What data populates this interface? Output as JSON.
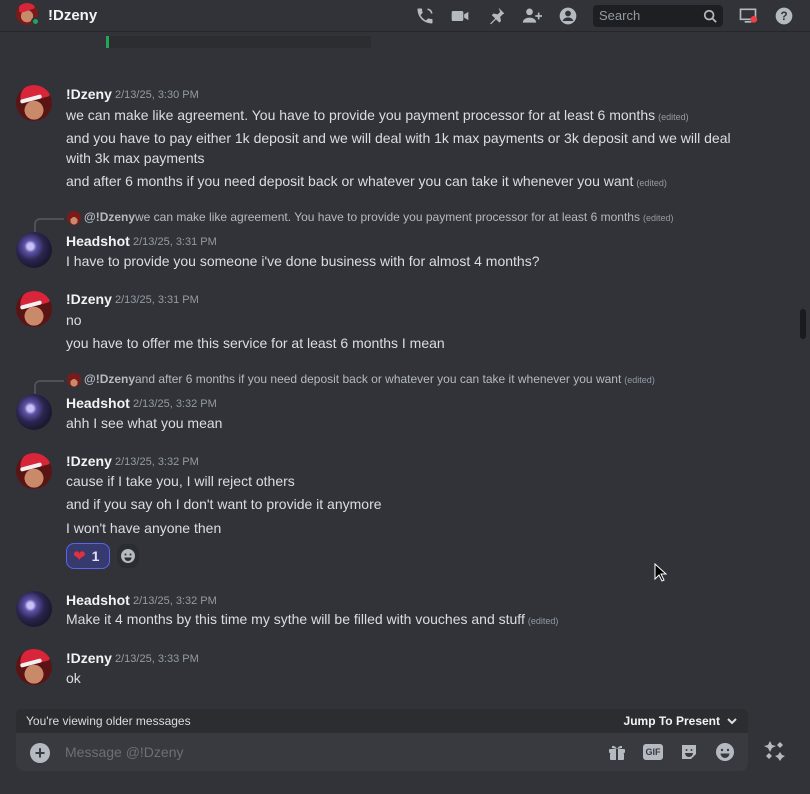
{
  "header": {
    "title": "!Dzeny",
    "search_placeholder": "Search",
    "icons": [
      "phone-icon",
      "video-icon",
      "pin-icon",
      "add-friend-icon",
      "profile-icon",
      "search-icon",
      "inbox-icon",
      "help-icon"
    ]
  },
  "messages": [
    {
      "author": "!Dzeny",
      "timestamp": "2/13/25, 3:30 PM",
      "lines": [
        {
          "text": "we can make like agreement. You have to provide you payment processor for at least 6 months",
          "edited": "(edited)"
        },
        {
          "text": "and you have to pay either 1k deposit and we will deal with 1k max payments or 3k deposit and we will deal with 3k max payments",
          "edited": ""
        },
        {
          "text": "and after 6 months if you need deposit back or whatever you can take it whenever you want",
          "edited": "(edited)"
        }
      ]
    },
    {
      "reply": {
        "name": "@!Dzeny",
        "text": "we can make like agreement. You have to provide you payment processor for at least 6 months",
        "edited": "(edited)"
      },
      "author": "Headshot",
      "timestamp": "2/13/25, 3:31 PM",
      "lines": [
        {
          "text": "I have to provide you someone i've done business with for almost 4 months?",
          "edited": ""
        }
      ]
    },
    {
      "author": "!Dzeny",
      "timestamp": "2/13/25, 3:31 PM",
      "lines": [
        {
          "text": "no",
          "edited": ""
        },
        {
          "text": "you have to offer me this service for at least 6 months I mean",
          "edited": ""
        }
      ]
    },
    {
      "reply": {
        "name": "@!Dzeny",
        "text": "and after 6 months if you need deposit back or whatever you can take it whenever you want",
        "edited": "(edited)"
      },
      "author": "Headshot",
      "timestamp": "2/13/25, 3:32 PM",
      "lines": [
        {
          "text": "ahh I see what you mean",
          "edited": ""
        }
      ]
    },
    {
      "author": "!Dzeny",
      "timestamp": "2/13/25, 3:32 PM",
      "lines": [
        {
          "text": "cause if I take you, I will reject others",
          "edited": ""
        },
        {
          "text": "and if you say oh I don't want to provide it anymore",
          "edited": ""
        },
        {
          "text": "I won't have anyone then",
          "edited": ""
        }
      ],
      "reaction": {
        "emoji": "❤",
        "count": "1"
      }
    },
    {
      "author": "Headshot",
      "timestamp": "2/13/25, 3:32 PM",
      "lines": [
        {
          "text": "Make it 4 months by this time my sythe will be filled with vouches and stuff",
          "edited": "(edited)"
        }
      ]
    },
    {
      "author": "!Dzeny",
      "timestamp": "2/13/25, 3:33 PM",
      "lines": [
        {
          "text": "ok",
          "edited": ""
        }
      ]
    }
  ],
  "older_banner": {
    "text": "You're viewing older messages",
    "jump": "Jump To Present"
  },
  "composer": {
    "placeholder": "Message @!Dzeny",
    "gif_label": "GIF"
  }
}
